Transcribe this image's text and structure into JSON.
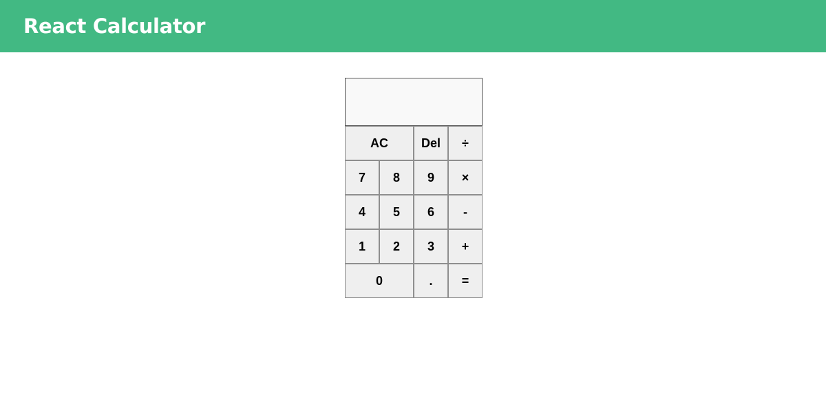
{
  "header": {
    "title": "React Calculator",
    "background": "#42b983"
  },
  "display": {
    "value": ""
  },
  "keys": {
    "ac": "AC",
    "del": "Del",
    "divide": "÷",
    "seven": "7",
    "eight": "8",
    "nine": "9",
    "multiply": "×",
    "four": "4",
    "five": "5",
    "six": "6",
    "subtract": "-",
    "one": "1",
    "two": "2",
    "three": "3",
    "add": "+",
    "zero": "0",
    "decimal": ".",
    "equals": "="
  }
}
